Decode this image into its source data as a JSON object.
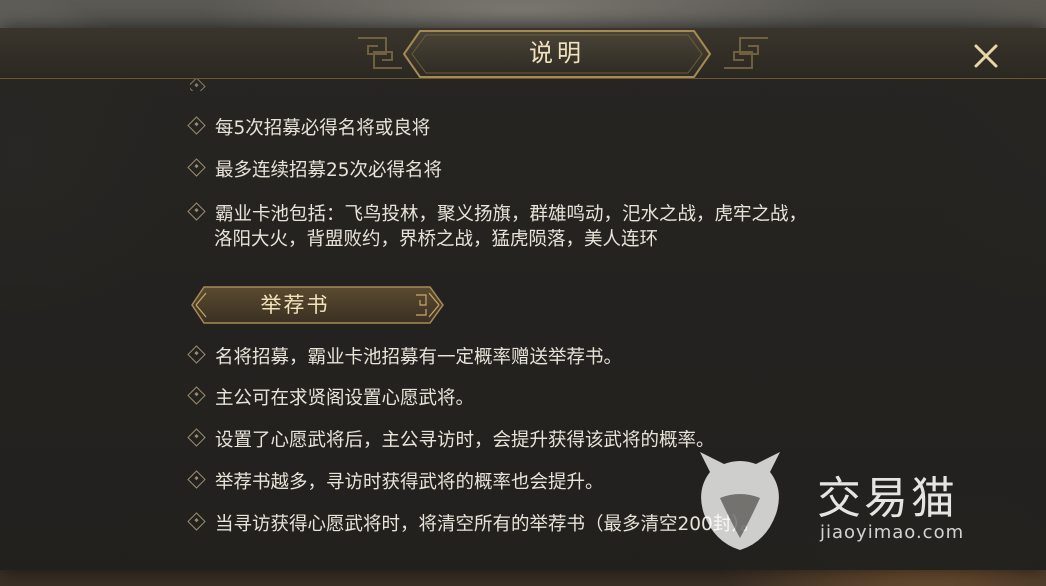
{
  "dialog": {
    "title": "说明",
    "close_icon": "close-x-icon"
  },
  "pool_section": {
    "items": [
      "每5次招募必得名将或良将",
      "最多连续招募25次必得名将"
    ],
    "pool_list_line1": "霸业卡池包括：飞鸟投林，聚义扬旗，群雄鸣动，汜水之战，虎牢之战，",
    "pool_list_line2": "洛阳大火，背盟败约，界桥之战，猛虎陨落，美人连环"
  },
  "recommend_section": {
    "title": "举荐书",
    "items": [
      "名将招募，霸业卡池招募有一定概率赠送举荐书。",
      "主公可在求贤阁设置心愿武将。",
      "设置了心愿武将后，主公寻访时，会提升获得该武将的概率。",
      "举荐书越多，寻访时获得武将的概率也会提升。",
      "当寻访获得心愿武将时，将清空所有的举荐书（最多清空200封）。"
    ]
  },
  "watermark": {
    "brand": "交易猫",
    "url": "jiaoyimao.com",
    "logo_icon": "cat-logo-icon"
  },
  "colors": {
    "title_gold": "#f1e2bd",
    "body_text": "#e8e3d8",
    "frame_gold": "#a58a55"
  }
}
